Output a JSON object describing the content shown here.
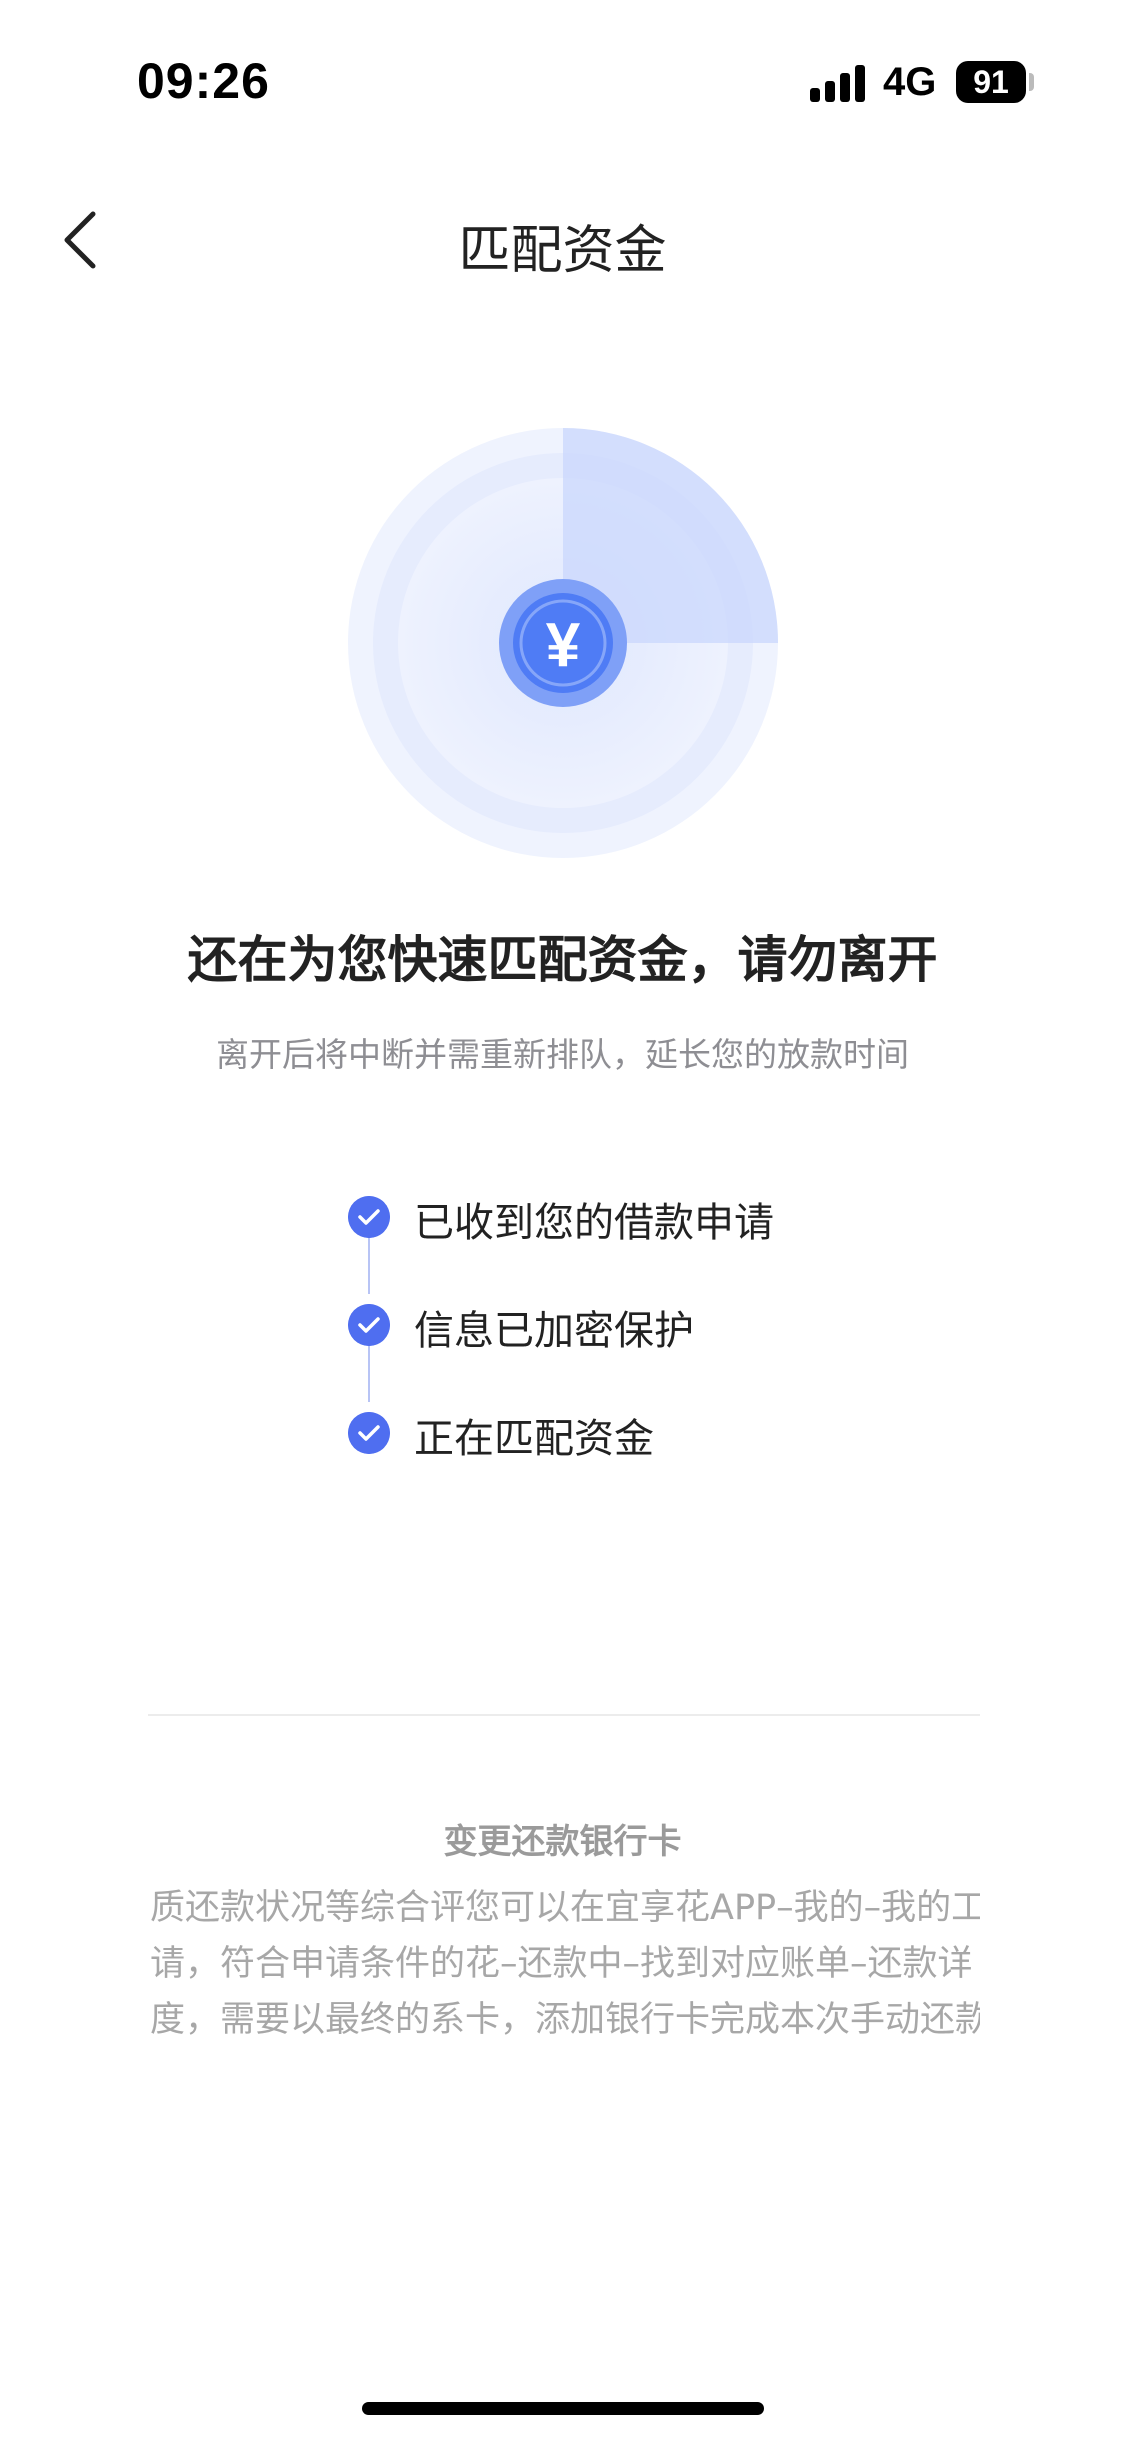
{
  "status_bar": {
    "time": "09:26",
    "network": "4G",
    "battery": "91"
  },
  "nav": {
    "title": "匹配资金",
    "back_icon": "chevron-left-icon"
  },
  "radar": {
    "symbol": "¥",
    "icon": "yuan-coin-icon",
    "accent_color": "#4f7cf5"
  },
  "headline": "还在为您快速匹配资金，请勿离开",
  "subline": "离开后将中断并需重新排队，延长您的放款时间",
  "steps": [
    {
      "label": "已收到您的借款申请",
      "icon": "check-circle-icon"
    },
    {
      "label": "信息已加密保护",
      "icon": "check-circle-icon"
    },
    {
      "label": "正在匹配资金",
      "icon": "check-circle-icon"
    }
  ],
  "notice": {
    "title": "变更还款银行卡",
    "lines": [
      "质还款状况等综合评您可以在宜享花APP–我的–我的工",
      "请，符合申请条件的花–还款中–找到对应账单–还款详",
      "度，需要以最终的系卡，添加银行卡完成本次手动还款"
    ]
  },
  "colors": {
    "check": "#4f6ef0",
    "muted_text": "#8e8e93"
  }
}
